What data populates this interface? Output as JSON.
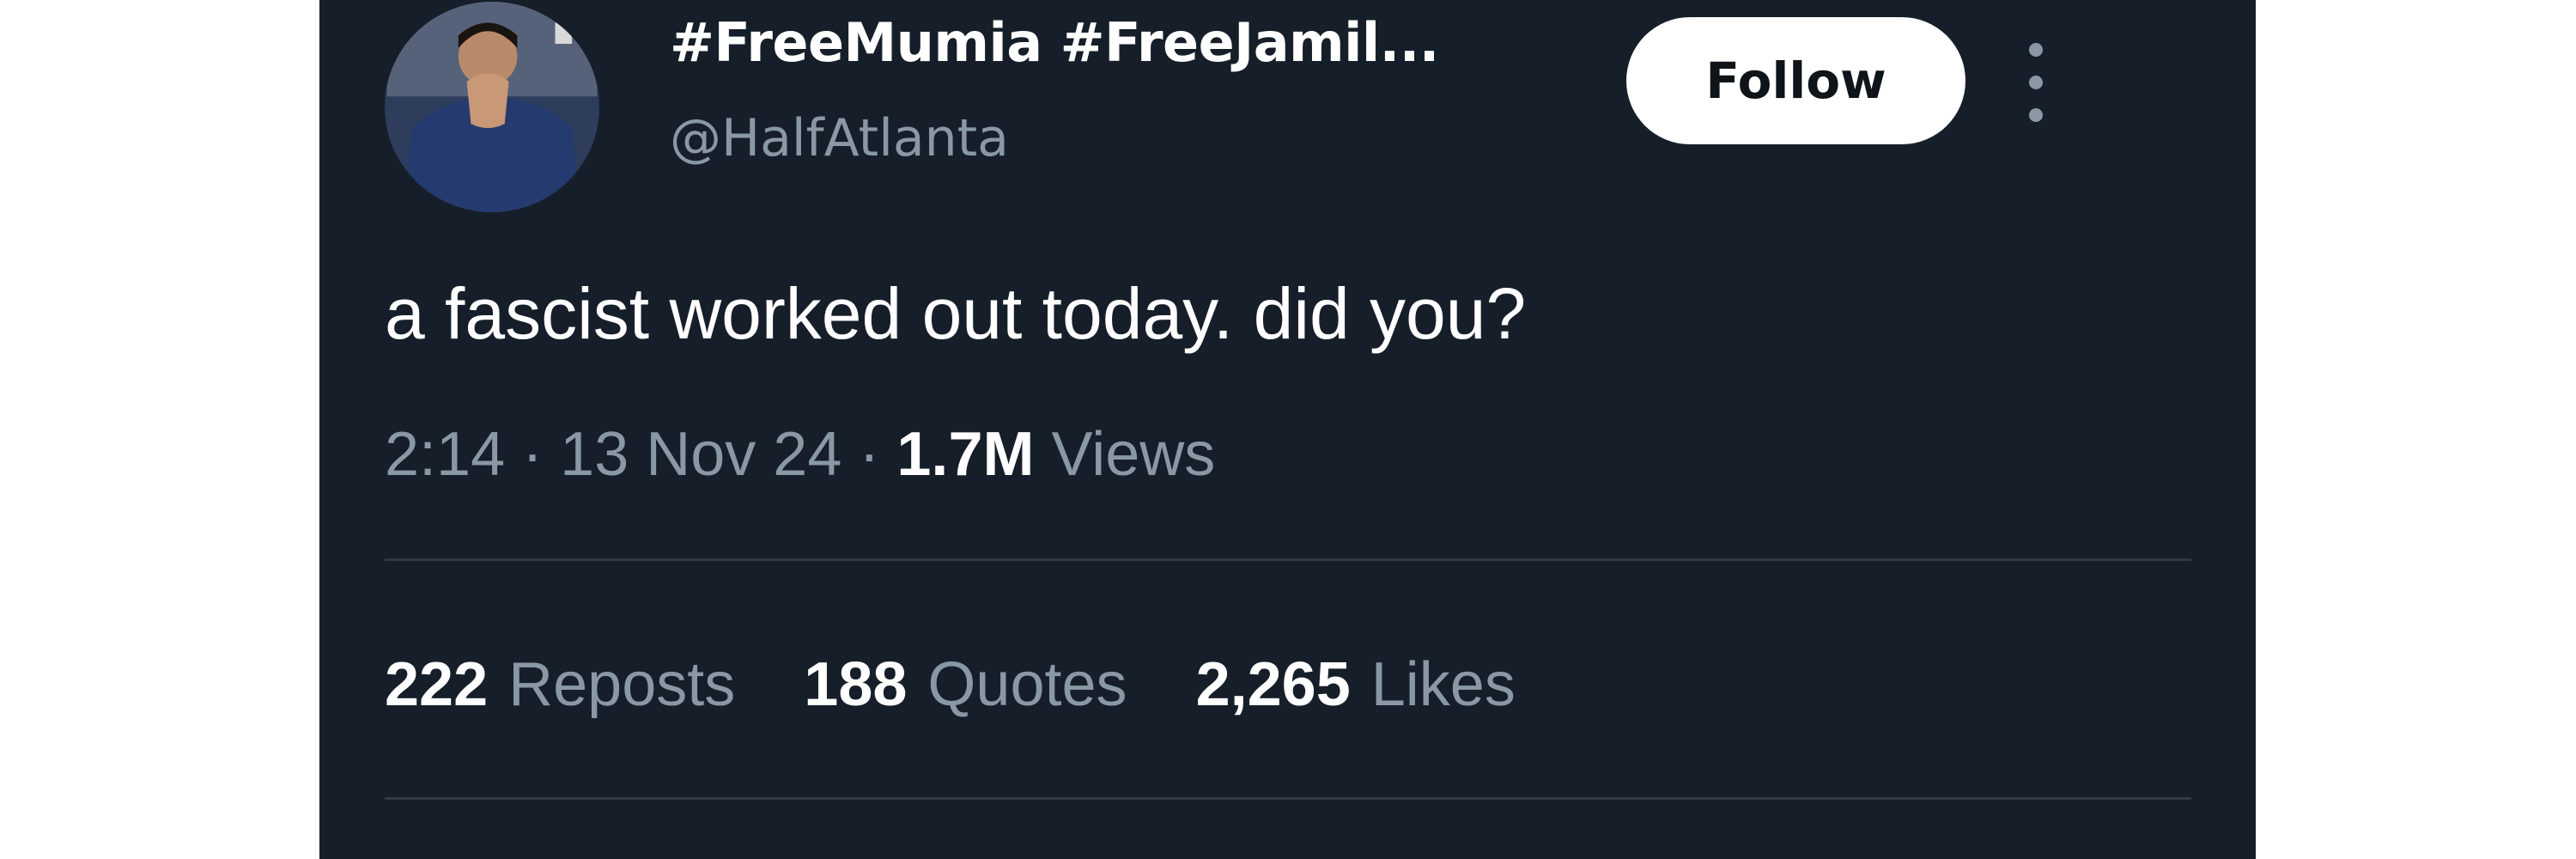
{
  "tweet": {
    "display_name": "#FreeMumia #FreeJamil...",
    "handle": "@HalfAtlanta",
    "follow_label": "Follow",
    "text": "a fascist worked out today. did you?",
    "time": "2:14",
    "date": "13 Nov 24",
    "separator": "·",
    "views_count": "1.7M",
    "views_label": "Views"
  },
  "stats": [
    {
      "count": "222",
      "label": "Reposts"
    },
    {
      "count": "188",
      "label": "Quotes"
    },
    {
      "count": "2,265",
      "label": "Likes"
    }
  ],
  "colors": {
    "background": "#161f29",
    "text_primary": "#ffffff",
    "text_secondary": "#8a98a6",
    "divider": "#2f3a45",
    "follow_button_bg": "#ffffff"
  },
  "icons": {
    "more": "more-vertical-icon"
  }
}
